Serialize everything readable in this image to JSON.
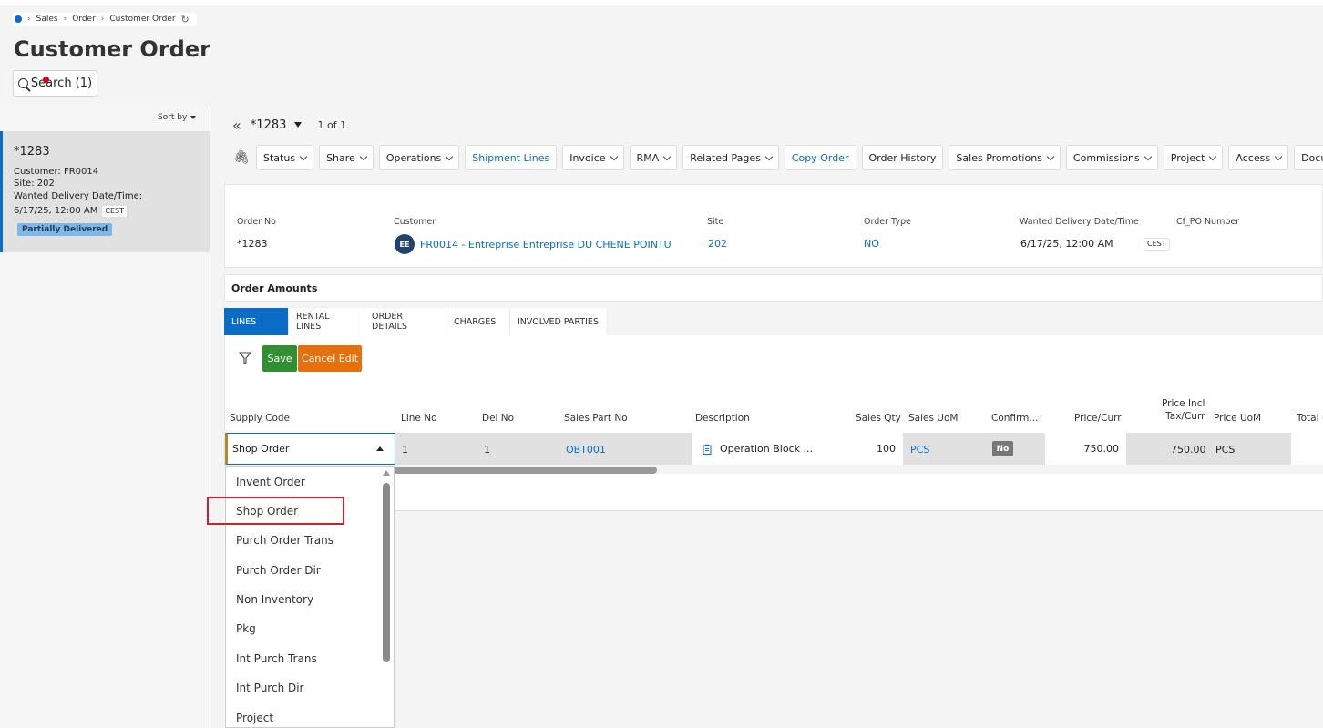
{
  "breadcrumb": [
    "Sales",
    "Order",
    "Customer Order"
  ],
  "page_title": "Customer Order",
  "search_label": "Search (1)",
  "sort_by_label": "Sort by",
  "record": {
    "id": "*1283",
    "customer_line": "Customer:  FR0014",
    "site_line": "Site:  202",
    "delivery_label": "Wanted Delivery Date/Time:",
    "delivery_value": "6/17/25, 12:00 AM",
    "tz": "CEST",
    "status": "Partially Delivered"
  },
  "nav": {
    "record_no": "*1283",
    "count": "1 of 1"
  },
  "toolbar": [
    {
      "label": "Status",
      "dropdown": true,
      "link": false
    },
    {
      "label": "Share",
      "dropdown": true,
      "link": false
    },
    {
      "label": "Operations",
      "dropdown": true,
      "link": false
    },
    {
      "label": "Shipment Lines",
      "dropdown": false,
      "link": true
    },
    {
      "label": "Invoice",
      "dropdown": true,
      "link": false
    },
    {
      "label": "RMA",
      "dropdown": true,
      "link": false
    },
    {
      "label": "Related Pages",
      "dropdown": true,
      "link": false
    },
    {
      "label": "Copy Order",
      "dropdown": false,
      "link": true
    },
    {
      "label": "Order History",
      "dropdown": false,
      "link": false
    },
    {
      "label": "Sales Promotions",
      "dropdown": true,
      "link": false
    },
    {
      "label": "Commissions",
      "dropdown": true,
      "link": false
    },
    {
      "label": "Project",
      "dropdown": true,
      "link": false
    },
    {
      "label": "Access",
      "dropdown": true,
      "link": false
    },
    {
      "label": "Docume",
      "dropdown": false,
      "link": false
    }
  ],
  "header": {
    "order_no_label": "Order No",
    "order_no": "*1283",
    "customer_label": "Customer",
    "customer_initials": "EE",
    "customer": "FR0014 - Entreprise Entreprise DU CHENE POINTU",
    "site_label": "Site",
    "site": "202",
    "order_type_label": "Order Type",
    "order_type": "NO",
    "delivery_label": "Wanted Delivery Date/Time",
    "delivery": "6/17/25, 12:00 AM",
    "tz": "CEST",
    "cf_po_label": "Cf_PO Number"
  },
  "order_amounts_label": "Order Amounts",
  "tabs": [
    "LINES",
    "RENTAL LINES",
    "ORDER DETAILS",
    "CHARGES",
    "INVOLVED PARTIES"
  ],
  "save_label": "Save",
  "cancel_label": "Cancel Edit",
  "columns": {
    "supply_code": "Supply Code",
    "line_no": "Line No",
    "del_no": "Del No",
    "sales_part_no": "Sales Part No",
    "description": "Description",
    "sales_qty": "Sales Qty",
    "sales_uom": "Sales UoM",
    "confirm": "Confirm...",
    "price_curr": "Price/Curr",
    "price_incl_1": "Price Incl",
    "price_incl_2": "Tax/Curr",
    "price_uom": "Price UoM",
    "total": "Total ("
  },
  "row": {
    "supply_code": "Shop Order",
    "line_no": "1",
    "del_no": "1",
    "sales_part_no": "OBT001",
    "description": "Operation Block ...",
    "sales_qty": "100",
    "sales_uom": "PCS",
    "confirm": "No",
    "price_curr": "750.00",
    "price_incl": "750.00",
    "price_uom": "PCS"
  },
  "dropdown_options": [
    "Invent Order",
    "Shop Order",
    "Purch Order Trans",
    "Purch Order Dir",
    "Non Inventory",
    "Pkg",
    "Int Purch Trans",
    "Int Purch Dir",
    "Project"
  ],
  "colors": {
    "primary": "#0b6cc6",
    "save": "#2f8f32",
    "cancel": "#e5700c",
    "highlight": "#d0212b"
  }
}
